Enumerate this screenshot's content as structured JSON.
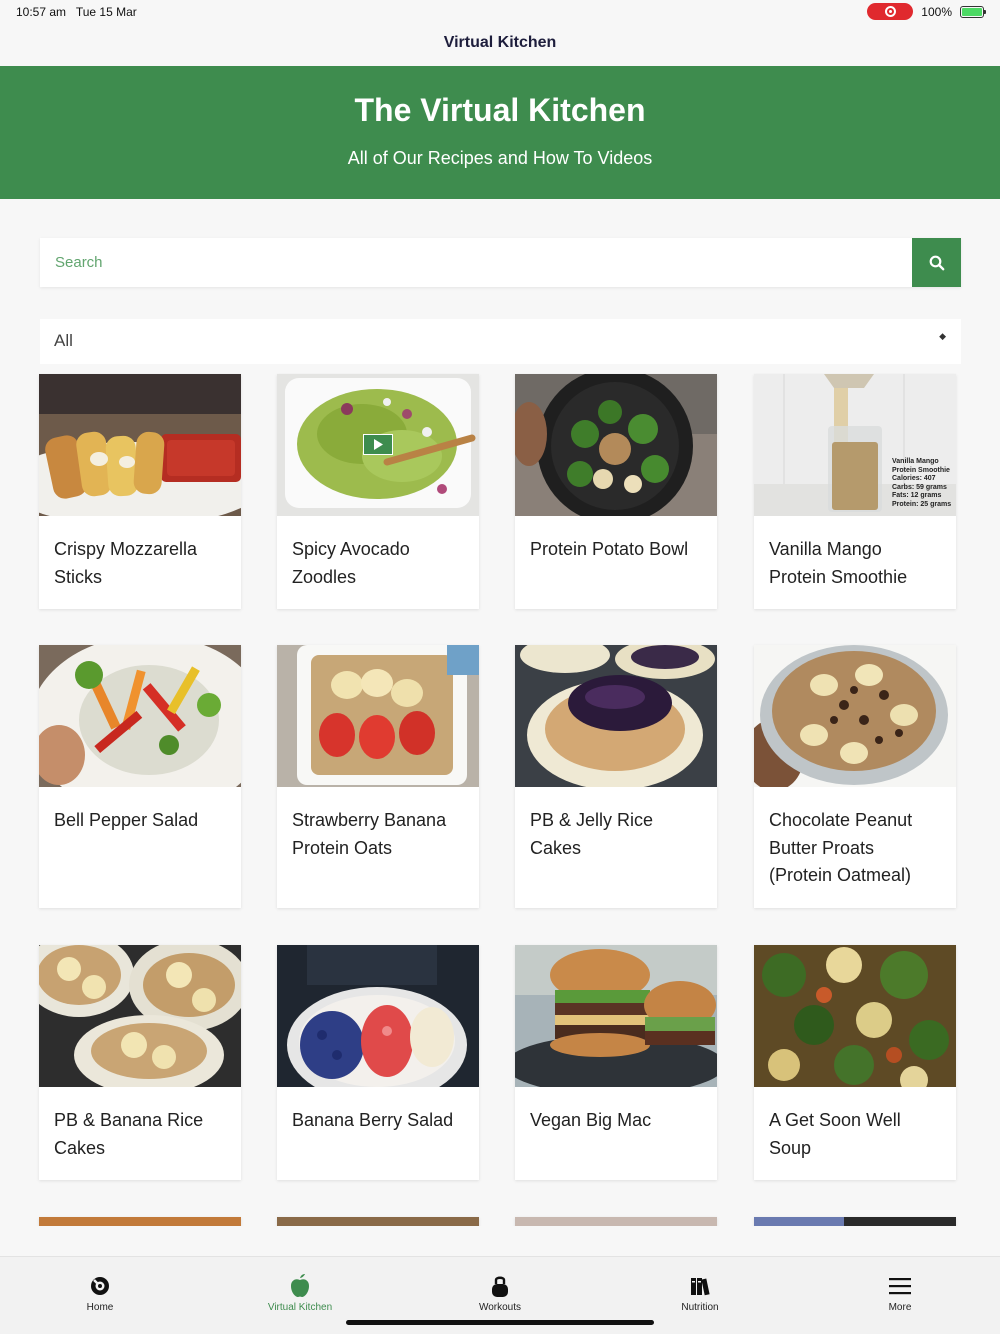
{
  "status_bar": {
    "time": "10:57 am",
    "date": "Tue 15 Mar",
    "battery": "100%"
  },
  "nav": {
    "title": "Virtual Kitchen"
  },
  "hero": {
    "title": "The Virtual Kitchen",
    "subtitle": "All of Our Recipes and How To Videos"
  },
  "search": {
    "placeholder": "Search"
  },
  "filter": {
    "selected": "All"
  },
  "recipes": [
    {
      "title": "Crispy Mozzarella Sticks"
    },
    {
      "title": "Spicy Avocado Zoodles"
    },
    {
      "title": "Protein Potato Bowl"
    },
    {
      "title": "Vanilla Mango Protein Smoothie"
    },
    {
      "title": "Bell Pepper Salad"
    },
    {
      "title": "Strawberry Banana Protein Oats"
    },
    {
      "title": "PB & Jelly Rice Cakes"
    },
    {
      "title": "Chocolate Peanut Butter Proats (Protein Oatmeal)"
    },
    {
      "title": "PB & Banana Rice Cakes"
    },
    {
      "title": "Banana Berry Salad"
    },
    {
      "title": "Vegan Big Mac"
    },
    {
      "title": "A Get Soon Well Soup"
    }
  ],
  "smoothie_label": [
    "Vanilla Mango",
    "Protein Smoothie",
    "Calories: 407",
    "Carbs: 59 grams",
    "Fats: 12 grams",
    "Protein: 25 grams"
  ],
  "tabs": [
    {
      "label": "Home",
      "icon": "home-icon",
      "active": false
    },
    {
      "label": "Virtual Kitchen",
      "icon": "apple-icon",
      "active": true
    },
    {
      "label": "Workouts",
      "icon": "kettlebell-icon",
      "active": false
    },
    {
      "label": "Nutrition",
      "icon": "books-icon",
      "active": false
    },
    {
      "label": "More",
      "icon": "menu-icon",
      "active": false
    }
  ],
  "colors": {
    "brand_green": "#3e8c4e",
    "background": "#f7f7f7"
  }
}
